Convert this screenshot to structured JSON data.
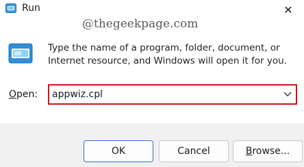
{
  "window": {
    "title": "Run",
    "close_glyph": "✕"
  },
  "watermark": "@thegeekpage.com",
  "description": "Type the name of a program, folder, document, or Internet resource, and Windows will open it for you.",
  "open": {
    "label_mnemonic": "O",
    "label_rest": "pen:",
    "value": "appwiz.cpl",
    "highlight_color": "#d4101a"
  },
  "buttons": {
    "ok": "OK",
    "cancel": "Cancel",
    "browse_mnemonic": "B",
    "browse_rest": "rowse..."
  },
  "icons": {
    "title": "run-icon",
    "dialog": "run-icon",
    "dropdown": "chevron-down-icon",
    "close": "close-icon"
  }
}
